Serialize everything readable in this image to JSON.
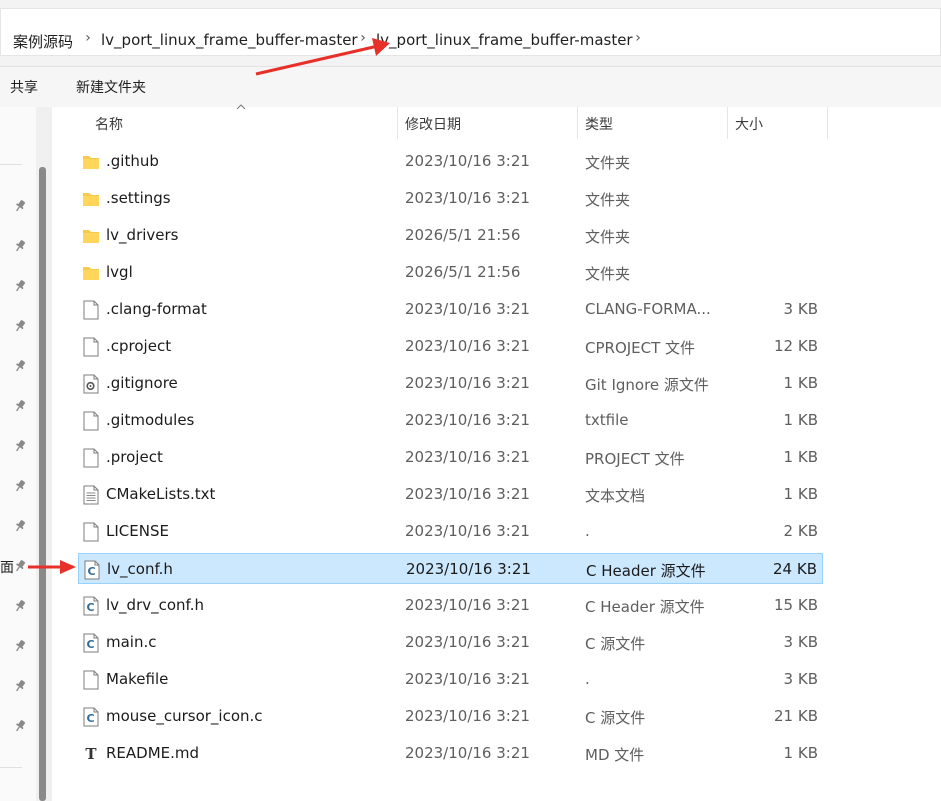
{
  "breadcrumb": [
    {
      "label": "案例源码"
    },
    {
      "label": "lv_port_linux_frame_buffer-master"
    },
    {
      "label": "lv_port_linux_frame_buffer-master"
    }
  ],
  "toolbar": {
    "share_label": "共享",
    "new_folder_label": "新建文件夹"
  },
  "nav": {
    "partial_label": "面"
  },
  "columns": {
    "name": "名称",
    "date": "修改日期",
    "type": "类型",
    "size": "大小"
  },
  "files": [
    {
      "name": ".github",
      "date": "2023/10/16 3:21",
      "type": "文件夹",
      "size": "",
      "icon": "folder-icon"
    },
    {
      "name": ".settings",
      "date": "2023/10/16 3:21",
      "type": "文件夹",
      "size": "",
      "icon": "folder-icon"
    },
    {
      "name": "lv_drivers",
      "date": "2026/5/1 21:56",
      "type": "文件夹",
      "size": "",
      "icon": "folder-icon"
    },
    {
      "name": "lvgl",
      "date": "2026/5/1 21:56",
      "type": "文件夹",
      "size": "",
      "icon": "folder-icon"
    },
    {
      "name": ".clang-format",
      "date": "2023/10/16 3:21",
      "type": "CLANG-FORMA...",
      "size": "3 KB",
      "icon": "blank-file-icon"
    },
    {
      "name": ".cproject",
      "date": "2023/10/16 3:21",
      "type": "CPROJECT 文件",
      "size": "12 KB",
      "icon": "blank-file-icon"
    },
    {
      "name": ".gitignore",
      "date": "2023/10/16 3:21",
      "type": "Git Ignore 源文件",
      "size": "1 KB",
      "icon": "settings-file-icon"
    },
    {
      "name": ".gitmodules",
      "date": "2023/10/16 3:21",
      "type": "txtfile",
      "size": "1 KB",
      "icon": "blank-file-icon"
    },
    {
      "name": ".project",
      "date": "2023/10/16 3:21",
      "type": "PROJECT 文件",
      "size": "1 KB",
      "icon": "blank-file-icon"
    },
    {
      "name": "CMakeLists.txt",
      "date": "2023/10/16 3:21",
      "type": "文本文档",
      "size": "1 KB",
      "icon": "text-file-icon"
    },
    {
      "name": "LICENSE",
      "date": "2023/10/16 3:21",
      "type": ".",
      "size": "2 KB",
      "icon": "blank-file-icon"
    },
    {
      "name": "lv_conf.h",
      "date": "2023/10/16 3:21",
      "type": "C Header 源文件",
      "size": "24 KB",
      "icon": "c-file-icon",
      "selected": true
    },
    {
      "name": "lv_drv_conf.h",
      "date": "2023/10/16 3:21",
      "type": "C Header 源文件",
      "size": "15 KB",
      "icon": "c-file-icon"
    },
    {
      "name": "main.c",
      "date": "2023/10/16 3:21",
      "type": "C 源文件",
      "size": "3 KB",
      "icon": "c-file-icon"
    },
    {
      "name": "Makefile",
      "date": "2023/10/16 3:21",
      "type": ".",
      "size": "3 KB",
      "icon": "blank-file-icon"
    },
    {
      "name": "mouse_cursor_icon.c",
      "date": "2023/10/16 3:21",
      "type": "C 源文件",
      "size": "21 KB",
      "icon": "c-file-icon"
    },
    {
      "name": "README.md",
      "date": "2023/10/16 3:21",
      "type": "MD 文件",
      "size": "1 KB",
      "icon": "markdown-file-icon"
    }
  ],
  "colors": {
    "selection_bg": "#cce8ff",
    "selection_border": "#99d1ff",
    "folder": "#f8c94a",
    "annotation_arrow": "#e8302a",
    "c_icon": "#2f6e9a"
  }
}
